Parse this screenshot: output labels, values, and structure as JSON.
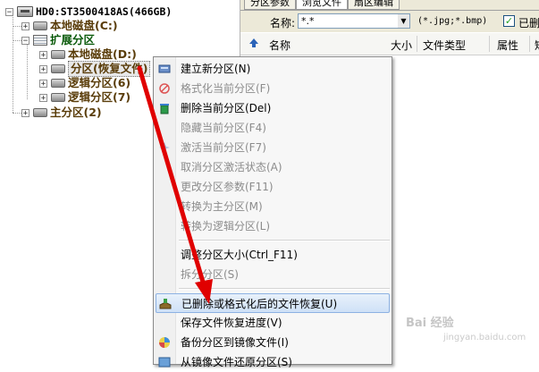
{
  "tree": {
    "disk": "HD0:ST3500418AS(466GB)",
    "local_disk_c": "本地磁盘(C:)",
    "extended": "扩展分区",
    "local_disk_d": "本地磁盘(D:)",
    "partition_recovery": "分区(恢复文件)",
    "logical_6": "逻辑分区(6)",
    "logical_7": "逻辑分区(7)",
    "primary_2": "主分区(2)"
  },
  "tabs": [
    "分区参数",
    "浏览文件",
    "扇区编辑"
  ],
  "filter": {
    "name_label": "名称:",
    "name_value": "*.*",
    "ext_hint": "(*.jpg;*.bmp)",
    "checkbox_label": "已删除",
    "checked": true
  },
  "columns": [
    "名称",
    "大小",
    "文件类型",
    "属性",
    "短"
  ],
  "context_menu": {
    "items": [
      {
        "label": "建立新分区(N)",
        "enabled": true,
        "icon": "new-partition-icon"
      },
      {
        "label": "格式化当前分区(F)",
        "enabled": false,
        "icon": "format-icon"
      },
      {
        "label": "删除当前分区(Del)",
        "enabled": true,
        "icon": "recycle-bin-icon"
      },
      {
        "label": "隐藏当前分区(F4)",
        "enabled": false,
        "icon": ""
      },
      {
        "label": "激活当前分区(F7)",
        "enabled": false,
        "icon": "activate-icon"
      },
      {
        "label": "取消分区激活状态(A)",
        "enabled": false,
        "icon": ""
      },
      {
        "label": "更改分区参数(F11)",
        "enabled": false,
        "icon": ""
      },
      {
        "label": "转换为主分区(M)",
        "enabled": false,
        "icon": ""
      },
      {
        "label": "转换为逻辑分区(L)",
        "enabled": false,
        "icon": ""
      },
      {
        "label": "调整分区大小(Ctrl_F11)",
        "enabled": true,
        "icon": ""
      },
      {
        "label": "拆分分区(S)",
        "enabled": false,
        "icon": ""
      },
      {
        "label": "已删除或格式化后的文件恢复(U)",
        "enabled": true,
        "icon": "file-recovery-icon",
        "highlighted": true
      },
      {
        "label": "保存文件恢复进度(V)",
        "enabled": true,
        "icon": ""
      },
      {
        "label": "备份分区到镜像文件(I)",
        "enabled": true,
        "icon": "backup-icon"
      },
      {
        "label": "从镜像文件还原分区(S)",
        "enabled": true,
        "icon": "restore-icon"
      }
    ]
  },
  "watermark": {
    "line1": "Bai 经验",
    "line2": "jingyan.baidu.com"
  },
  "colors": {
    "arrow": "#e00000",
    "highlight": "#cfe1f7",
    "tree_brown": "#5a3d0a",
    "tree_green": "#0a5a0a"
  }
}
